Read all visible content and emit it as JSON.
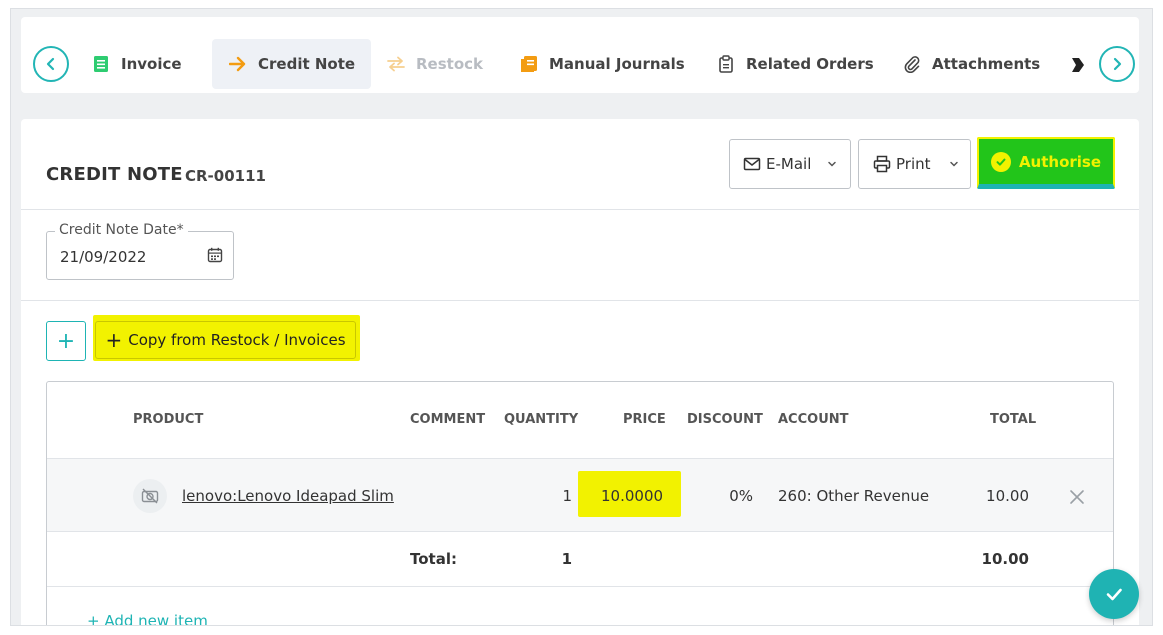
{
  "tabs": [
    {
      "label": "Invoice",
      "icon": "invoice-icon",
      "state": "normal"
    },
    {
      "label": "Credit Note",
      "icon": "arrow-right-icon",
      "state": "active"
    },
    {
      "label": "Restock",
      "icon": "swap-arrows-icon",
      "state": "disabled"
    },
    {
      "label": "Manual Journals",
      "icon": "journal-icon",
      "state": "normal"
    },
    {
      "label": "Related Orders",
      "icon": "clipboard-icon",
      "state": "normal"
    },
    {
      "label": "Attachments",
      "icon": "paperclip-icon",
      "state": "normal"
    }
  ],
  "header": {
    "title": "CREDIT NOTE",
    "doc_number": "CR-00111",
    "email_label": "E-Mail",
    "print_label": "Print",
    "authorise_label": "Authorise"
  },
  "date_field": {
    "label": "Credit Note Date*",
    "value": "21/09/2022"
  },
  "actions": {
    "add_symbol": "+",
    "copy_label": "Copy from Restock / Invoices"
  },
  "table": {
    "columns": {
      "product": "PRODUCT",
      "comment": "COMMENT",
      "quantity": "QUANTITY",
      "price": "PRICE",
      "discount": "DISCOUNT",
      "account": "ACCOUNT",
      "total": "TOTAL"
    },
    "rows": [
      {
        "product": "lenovo:Lenovo Ideapad Slim",
        "comment": "",
        "quantity": "1",
        "price": "10.0000",
        "discount": "0%",
        "account": "260: Other Revenue",
        "total": "10.00"
      }
    ],
    "totals": {
      "label": "Total:",
      "quantity": "1",
      "total": "10.00"
    },
    "add_line_label": "+ Add new item"
  },
  "colors": {
    "accent": "#1fb3b3",
    "authorise_bg": "#22c51a",
    "highlight": "#f2f200",
    "tab_active_icon": "#f39c12",
    "invoice_icon": "#2ecc71"
  }
}
